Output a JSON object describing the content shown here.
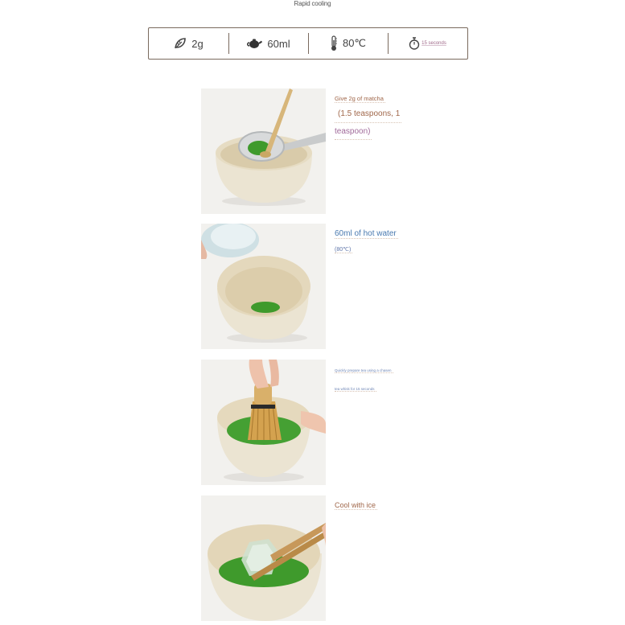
{
  "header": {
    "subtitle": "Rapid cooling"
  },
  "specs": [
    {
      "icon": "tea-leaf-icon",
      "label": "2g"
    },
    {
      "icon": "teapot-icon",
      "label": "60ml"
    },
    {
      "icon": "thermometer-icon",
      "label": "80℃"
    },
    {
      "icon": "timer-icon",
      "label": "15 seconds"
    }
  ],
  "steps": [
    {
      "image": "matcha-in-sieve-photo",
      "lines": [
        "Give 2g of matcha",
        "(1.5 teaspoons, 1",
        "teaspoon)"
      ]
    },
    {
      "image": "pour-hot-water-photo",
      "lines": [
        "60ml of hot water",
        "(80℃)"
      ]
    },
    {
      "image": "whisk-with-chasen-photo",
      "lines": [
        "Quickly prepare tea using a chasen",
        "tea whisk for 15 seconds"
      ]
    },
    {
      "image": "ice-with-tongs-photo",
      "lines": [
        "Cool with ice"
      ]
    }
  ],
  "colors": {
    "border": "#7a6a5e",
    "caption_brown": "#a0674a",
    "caption_blue": "#4a7ab0",
    "matcha_green": "#3f9a2c"
  }
}
